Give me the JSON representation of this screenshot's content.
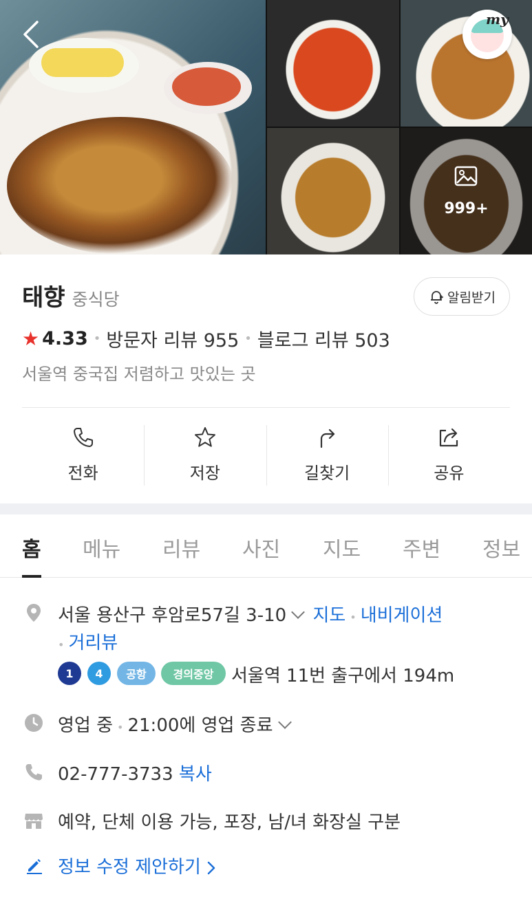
{
  "header": {
    "photo_count": "999+",
    "my_label": "my"
  },
  "place": {
    "name": "태향",
    "category": "중식당",
    "alarm_label": "알림받기",
    "rating": "4.33",
    "visitor_reviews": "방문자 리뷰 955",
    "blog_reviews": "블로그 리뷰 503",
    "description": "서울역 중국집 저렴하고 맛있는 곳"
  },
  "actions": [
    {
      "label": "전화",
      "icon": "phone-icon"
    },
    {
      "label": "저장",
      "icon": "star-icon"
    },
    {
      "label": "길찾기",
      "icon": "directions-icon"
    },
    {
      "label": "공유",
      "icon": "share-icon"
    }
  ],
  "tabs": [
    "홈",
    "메뉴",
    "리뷰",
    "사진",
    "지도",
    "주변",
    "정보"
  ],
  "active_tab": "홈",
  "info": {
    "address": "서울 용산구 후암로57길 3-10",
    "map_link": "지도",
    "navigation_link": "내비게이션",
    "streetview_link": "거리뷰",
    "subway": {
      "lines": [
        {
          "label": "1",
          "color": "#1f3a93"
        },
        {
          "label": "4",
          "color": "#2f9be0"
        },
        {
          "label": "공항",
          "color": "#73b6e6"
        },
        {
          "label": "경의중앙",
          "color": "#6fc7a5"
        }
      ],
      "exit_text": "서울역 11번 출구에서 194m"
    },
    "hours_status": "영업 중",
    "hours_detail": "21:00에 영업 종료",
    "phone": "02-777-3733",
    "copy_label": "복사",
    "amenities": "예약, 단체 이용 가능, 포장, 남/녀 화장실 구분",
    "edit_suggestion": "정보 수정 제안하기"
  },
  "colors": {
    "accent_link": "#1a6ed8",
    "star": "#e8322c"
  }
}
